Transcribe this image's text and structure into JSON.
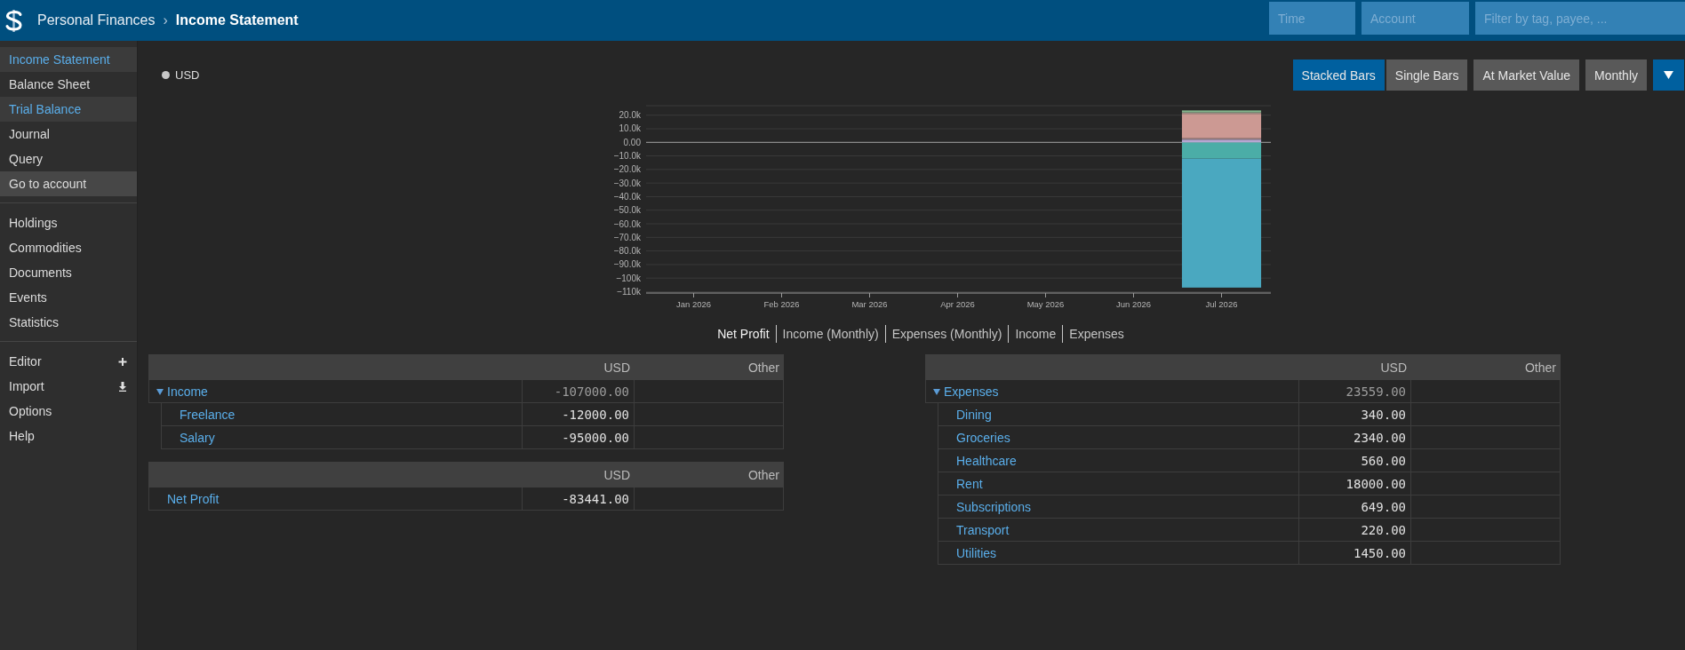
{
  "header": {
    "title": "Personal Finances",
    "separator": "›",
    "page": "Income Statement",
    "filters": [
      {
        "placeholder": "Time"
      },
      {
        "placeholder": "Account"
      },
      {
        "placeholder": "Filter by tag, payee, ..."
      }
    ]
  },
  "sidebar": {
    "sections": [
      {
        "items": [
          {
            "label": "Income Statement",
            "kind": "plain",
            "selected": true,
            "highlighted": false
          },
          {
            "label": "Balance Sheet",
            "kind": "plain",
            "selected": false,
            "highlighted": false
          },
          {
            "label": "Trial Balance",
            "kind": "plain",
            "selected": true,
            "highlighted": false
          },
          {
            "label": "Journal",
            "kind": "plain",
            "selected": false,
            "highlighted": false
          },
          {
            "label": "Query",
            "kind": "plain",
            "selected": false,
            "highlighted": false
          },
          {
            "label": "Go to account",
            "kind": "plain",
            "selected": false,
            "highlighted": true
          }
        ]
      },
      {
        "items": [
          {
            "label": "Holdings",
            "kind": "plain",
            "selected": false,
            "highlighted": false
          },
          {
            "label": "Commodities",
            "kind": "plain",
            "selected": false,
            "highlighted": false
          },
          {
            "label": "Documents",
            "kind": "plain",
            "selected": false,
            "highlighted": false
          },
          {
            "label": "Events",
            "kind": "plain",
            "selected": false,
            "highlighted": false
          },
          {
            "label": "Statistics",
            "kind": "plain",
            "selected": false,
            "highlighted": false
          }
        ]
      },
      {
        "items": [
          {
            "label": "Editor",
            "kind": "plus",
            "selected": false,
            "highlighted": false
          },
          {
            "label": "Import",
            "kind": "download",
            "selected": false,
            "highlighted": false
          },
          {
            "label": "Options",
            "kind": "plain",
            "selected": false,
            "highlighted": false
          },
          {
            "label": "Help",
            "kind": "plain",
            "selected": false,
            "highlighted": false
          }
        ]
      }
    ]
  },
  "chart": {
    "legend": [
      {
        "label": "USD",
        "color": "#c8c8c8"
      }
    ],
    "modes": [
      {
        "label": "Stacked Bars",
        "selected": true
      },
      {
        "label": "Single Bars",
        "selected": false
      }
    ],
    "options": [
      "At Market Value",
      "Monthly"
    ],
    "chart_data": {
      "type": "bar",
      "stacked": true,
      "grid": true,
      "categories": [
        "Jan 2026",
        "Feb 2026",
        "Mar 2026",
        "Apr 2026",
        "May 2026",
        "Jun 2026",
        "Jul 2026"
      ],
      "ylim": [
        -111000,
        27000
      ],
      "yticks": [
        {
          "value": 20000,
          "label": "20.0k"
        },
        {
          "value": 10000,
          "label": "10.0k"
        },
        {
          "value": 0,
          "label": "0.00"
        },
        {
          "value": -10000,
          "label": "−10.0k"
        },
        {
          "value": -20000,
          "label": "−20.0k"
        },
        {
          "value": -30000,
          "label": "−30.0k"
        },
        {
          "value": -40000,
          "label": "−40.0k"
        },
        {
          "value": -50000,
          "label": "−50.0k"
        },
        {
          "value": -60000,
          "label": "−60.0k"
        },
        {
          "value": -70000,
          "label": "−70.0k"
        },
        {
          "value": -80000,
          "label": "−80.0k"
        },
        {
          "value": -90000,
          "label": "−90.0k"
        },
        {
          "value": -100000,
          "label": "−100k"
        },
        {
          "value": -110000,
          "label": "−110k"
        }
      ],
      "series": [
        {
          "color": "#4badA7",
          "values": [
            null,
            null,
            null,
            null,
            null,
            null,
            -12000
          ]
        },
        {
          "color": "#4aa8c0",
          "values": [
            null,
            null,
            null,
            null,
            null,
            null,
            -95000
          ]
        },
        {
          "color": "#b6a7d2",
          "values": [
            null,
            null,
            null,
            null,
            null,
            null,
            2000
          ]
        },
        {
          "color": "#8f7b80",
          "values": [
            null,
            null,
            null,
            null,
            null,
            null,
            1000
          ]
        },
        {
          "color": "#cc9993",
          "values": [
            null,
            null,
            null,
            null,
            null,
            null,
            18000
          ]
        },
        {
          "color": "#9b8a80",
          "values": [
            null,
            null,
            null,
            null,
            null,
            null,
            1000
          ]
        },
        {
          "color": "#84b48c",
          "values": [
            null,
            null,
            null,
            null,
            null,
            null,
            1500
          ]
        }
      ]
    },
    "tabs": [
      {
        "label": "Net Profit",
        "selected": true
      },
      {
        "label": "Income (Monthly)",
        "selected": false
      },
      {
        "label": "Expenses (Monthly)",
        "selected": false
      },
      {
        "label": "Income",
        "selected": false
      },
      {
        "label": "Expenses",
        "selected": false
      }
    ]
  },
  "left_column": {
    "tables": [
      {
        "columns": [
          "USD",
          "Other"
        ],
        "rows": [
          {
            "account": "Income",
            "usd": "-107000.00",
            "expanded": true,
            "children": [
              {
                "account": "Freelance",
                "usd": "-12000.00"
              },
              {
                "account": "Salary",
                "usd": "-95000.00"
              }
            ]
          }
        ]
      },
      {
        "columns": [
          "USD",
          "Other"
        ],
        "rows": [
          {
            "account": "Net Profit",
            "usd": "-83441.00"
          }
        ]
      }
    ]
  },
  "right_column": {
    "tables": [
      {
        "columns": [
          "USD",
          "Other"
        ],
        "rows": [
          {
            "account": "Expenses",
            "usd": "23559.00",
            "expanded": true,
            "children": [
              {
                "account": "Dining",
                "usd": "340.00"
              },
              {
                "account": "Groceries",
                "usd": "2340.00"
              },
              {
                "account": "Healthcare",
                "usd": "560.00"
              },
              {
                "account": "Rent",
                "usd": "18000.00"
              },
              {
                "account": "Subscriptions",
                "usd": "649.00"
              },
              {
                "account": "Transport",
                "usd": "220.00"
              },
              {
                "account": "Utilities",
                "usd": "1450.00"
              }
            ]
          }
        ]
      }
    ]
  }
}
